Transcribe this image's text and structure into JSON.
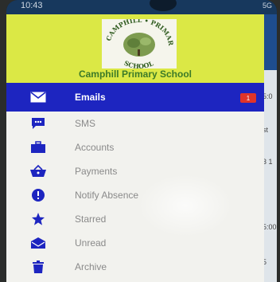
{
  "status_bar": {
    "time": "10:43",
    "signal": "5G"
  },
  "behind_panel": {
    "snippets": [
      "5:0",
      "st",
      "3 1",
      "5:00",
      "5"
    ]
  },
  "header": {
    "logo_text": "CAMPHILL PRIMARY SCHOOL",
    "school_name": "Camphill Primary School",
    "bg_color": "#dbe845"
  },
  "menu": {
    "items": [
      {
        "label": "Emails",
        "icon": "envelope-icon",
        "selected": true,
        "badge": "1"
      },
      {
        "label": "SMS",
        "icon": "message-icon",
        "selected": false
      },
      {
        "label": "Accounts",
        "icon": "briefcase-icon",
        "selected": false
      },
      {
        "label": "Payments",
        "icon": "basket-icon",
        "selected": false
      },
      {
        "label": "Notify Absence",
        "icon": "alert-icon",
        "selected": false
      },
      {
        "label": "Starred",
        "icon": "star-icon",
        "selected": false
      },
      {
        "label": "Unread",
        "icon": "open-envelope-icon",
        "selected": false
      },
      {
        "label": "Archive",
        "icon": "trash-icon",
        "selected": false
      }
    ],
    "selected_color": "#1d25c0",
    "icon_color": "#1d25c0"
  }
}
